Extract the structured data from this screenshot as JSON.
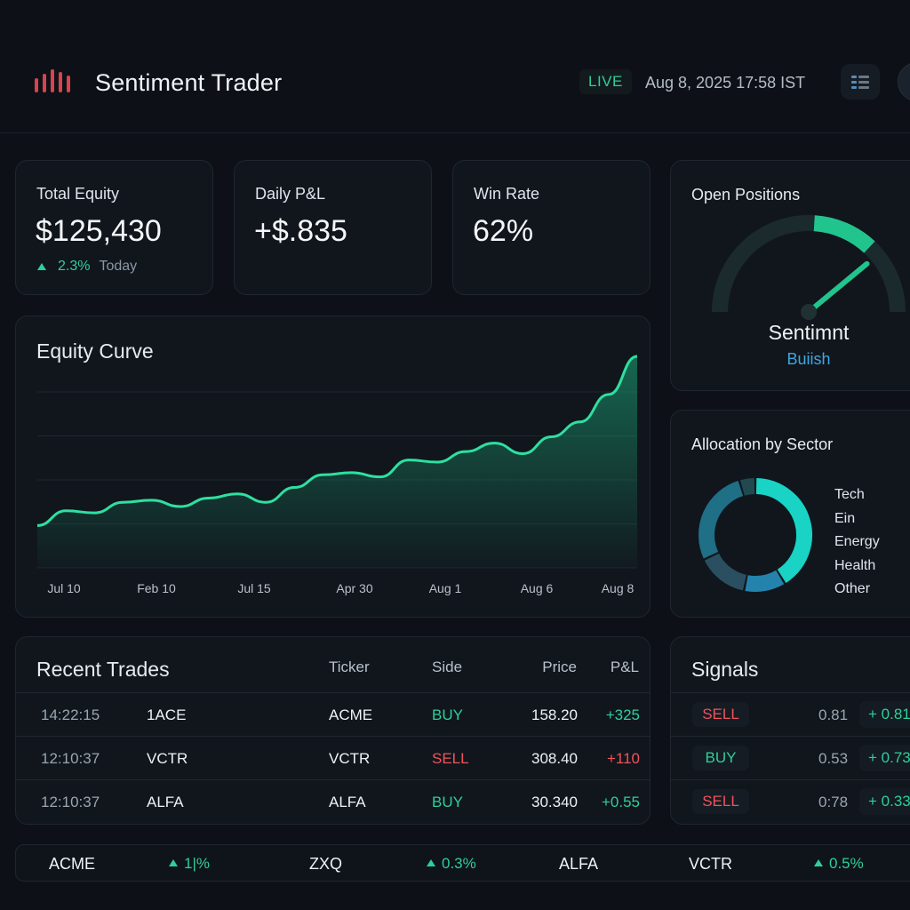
{
  "header": {
    "app_title": "Sentiment Trader",
    "live_label": "LIVE",
    "datetime": "Aug 8, 2025  17:58 IST",
    "logo_icon": "bars-logo-icon",
    "menu_icon": "list-menu-icon"
  },
  "kpis": {
    "equity": {
      "label": "Total Equity",
      "value": "$125,430",
      "change": "2.3%",
      "period": "Today"
    },
    "daily_pnl": {
      "label": "Daily P&L",
      "value": "+$.835"
    },
    "win_rate": {
      "label": "Win Rate",
      "value": "62%"
    }
  },
  "open_positions": {
    "title": "Open Positions",
    "gauge_label": "Sentimnt",
    "gauge_value": "Buiish",
    "level": 0.78
  },
  "equity_curve": {
    "title": "Equity Curve",
    "x_labels": [
      "Jul 10",
      "Feb 10",
      "Jul 15",
      "Apr 30",
      "Aug 1",
      "Aug 6",
      "Aug 8"
    ]
  },
  "chart_data": {
    "type": "area",
    "title": "Equity Curve",
    "xlabel": "",
    "ylabel": "",
    "grid": true,
    "x": [
      "Jul 10",
      "Feb 10",
      "Jul 15",
      "Apr 30",
      "Aug 1",
      "Aug 6",
      "Aug 8"
    ],
    "series": [
      {
        "values": [
          20,
          27,
          26,
          31,
          32,
          29,
          33,
          35,
          31,
          38,
          44,
          45,
          43,
          51,
          50,
          55,
          59,
          54,
          62,
          69,
          82,
          100
        ]
      }
    ]
  },
  "allocation": {
    "title": "Allocation by Sector",
    "items": [
      {
        "name": "Tech",
        "pct": "45%",
        "value": 45,
        "color": "#19d3c5"
      },
      {
        "name": "Ein",
        "pct": "30%",
        "value": 30,
        "color": "#1f6f86"
      },
      {
        "name": "Energy",
        "pct": "16%",
        "value": 16,
        "color": "#2a4f61"
      },
      {
        "name": "Health",
        "pct": "13%",
        "value": 13,
        "color": "#2483ad"
      },
      {
        "name": "Other",
        "pct": "5%",
        "value": 5,
        "color": "#214a50"
      }
    ]
  },
  "recent_trades": {
    "title": "Recent Trades",
    "headers": {
      "ticker": "Ticker",
      "side": "Side",
      "price": "Price",
      "pnl": "P&L"
    },
    "rows": [
      {
        "time": "14:22:15",
        "name": "1ACE",
        "ticker": "ACME",
        "side": "BUY",
        "price": "158.20",
        "pnl": "+325"
      },
      {
        "time": "12:10:37",
        "name": "VCTR",
        "ticker": "VCTR",
        "side": "SELL",
        "price": "308.40",
        "pnl": "+110"
      },
      {
        "time": "12:10:37",
        "name": "ALFA",
        "ticker": "ALFA",
        "side": "BUY",
        "price": "30.340",
        "pnl": "+0.55"
      }
    ]
  },
  "signals": {
    "title": "Signals",
    "rows": [
      {
        "action": "SELL",
        "score": "0.81",
        "conf": "+ 0.81"
      },
      {
        "action": "BUY",
        "score": "0.53",
        "conf": "+ 0.73"
      },
      {
        "action": "SELL",
        "score": "0:78",
        "conf": "+ 0.33"
      }
    ]
  },
  "ticker_tape": {
    "items": [
      {
        "symbol": "ACME",
        "change": "1|%"
      },
      {
        "symbol": "ZXQ",
        "change": "0.3%"
      },
      {
        "symbol": "ALFA",
        "change": ""
      },
      {
        "symbol": "VCTR",
        "change": "0.5%"
      }
    ]
  },
  "colors": {
    "accent": "#2ecf9a",
    "negative": "#f0535b",
    "info": "#3fa7e0",
    "logo": "#e0474f"
  }
}
